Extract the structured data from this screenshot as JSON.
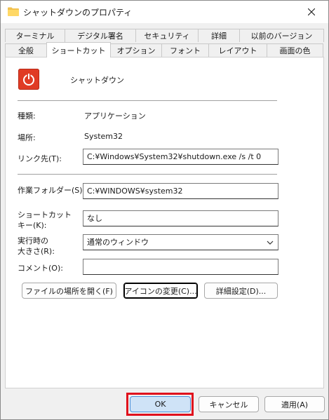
{
  "window": {
    "title": "シャットダウンのプロパティ",
    "close_icon": "close-icon",
    "folder_icon": "folder-icon"
  },
  "tabs": {
    "row1": [
      {
        "label": "ターミナル"
      },
      {
        "label": "デジタル署名"
      },
      {
        "label": "セキュリティ"
      },
      {
        "label": "詳細"
      },
      {
        "label": "以前のバージョン"
      }
    ],
    "row2": [
      {
        "label": "全般"
      },
      {
        "label": "ショートカット",
        "active": true
      },
      {
        "label": "オプション"
      },
      {
        "label": "フォント"
      },
      {
        "label": "レイアウト"
      },
      {
        "label": "画面の色"
      }
    ]
  },
  "shortcut": {
    "name": "シャットダウン",
    "icon": "power-icon",
    "type_label": "種類:",
    "type_value": "アプリケーション",
    "location_label": "場所:",
    "location_value": "System32",
    "target_label": "リンク先(T):",
    "target_value": "C:¥Windows¥System32¥shutdown.exe /s /t 0",
    "startin_label": "作業フォルダー(S):",
    "startin_value": "C:¥WINDOWS¥system32",
    "hotkey_label_line1": "ショートカット",
    "hotkey_label_line2": "キー(K):",
    "hotkey_value": "なし",
    "run_label_line1": "実行時の",
    "run_label_line2": "大きさ(R):",
    "run_value": "通常のウィンドウ",
    "comment_label": "コメント(O):",
    "comment_value": "",
    "open_location_button": "ファイルの場所を開く(F)",
    "change_icon_button": "アイコンの変更(C)...",
    "advanced_button": "詳細設定(D)..."
  },
  "footer": {
    "ok_label": "OK",
    "cancel_label": "キャンセル",
    "apply_label": "適用(A)"
  },
  "colors": {
    "power_icon_bg": "#e03b24",
    "highlight": "#e0101c"
  }
}
